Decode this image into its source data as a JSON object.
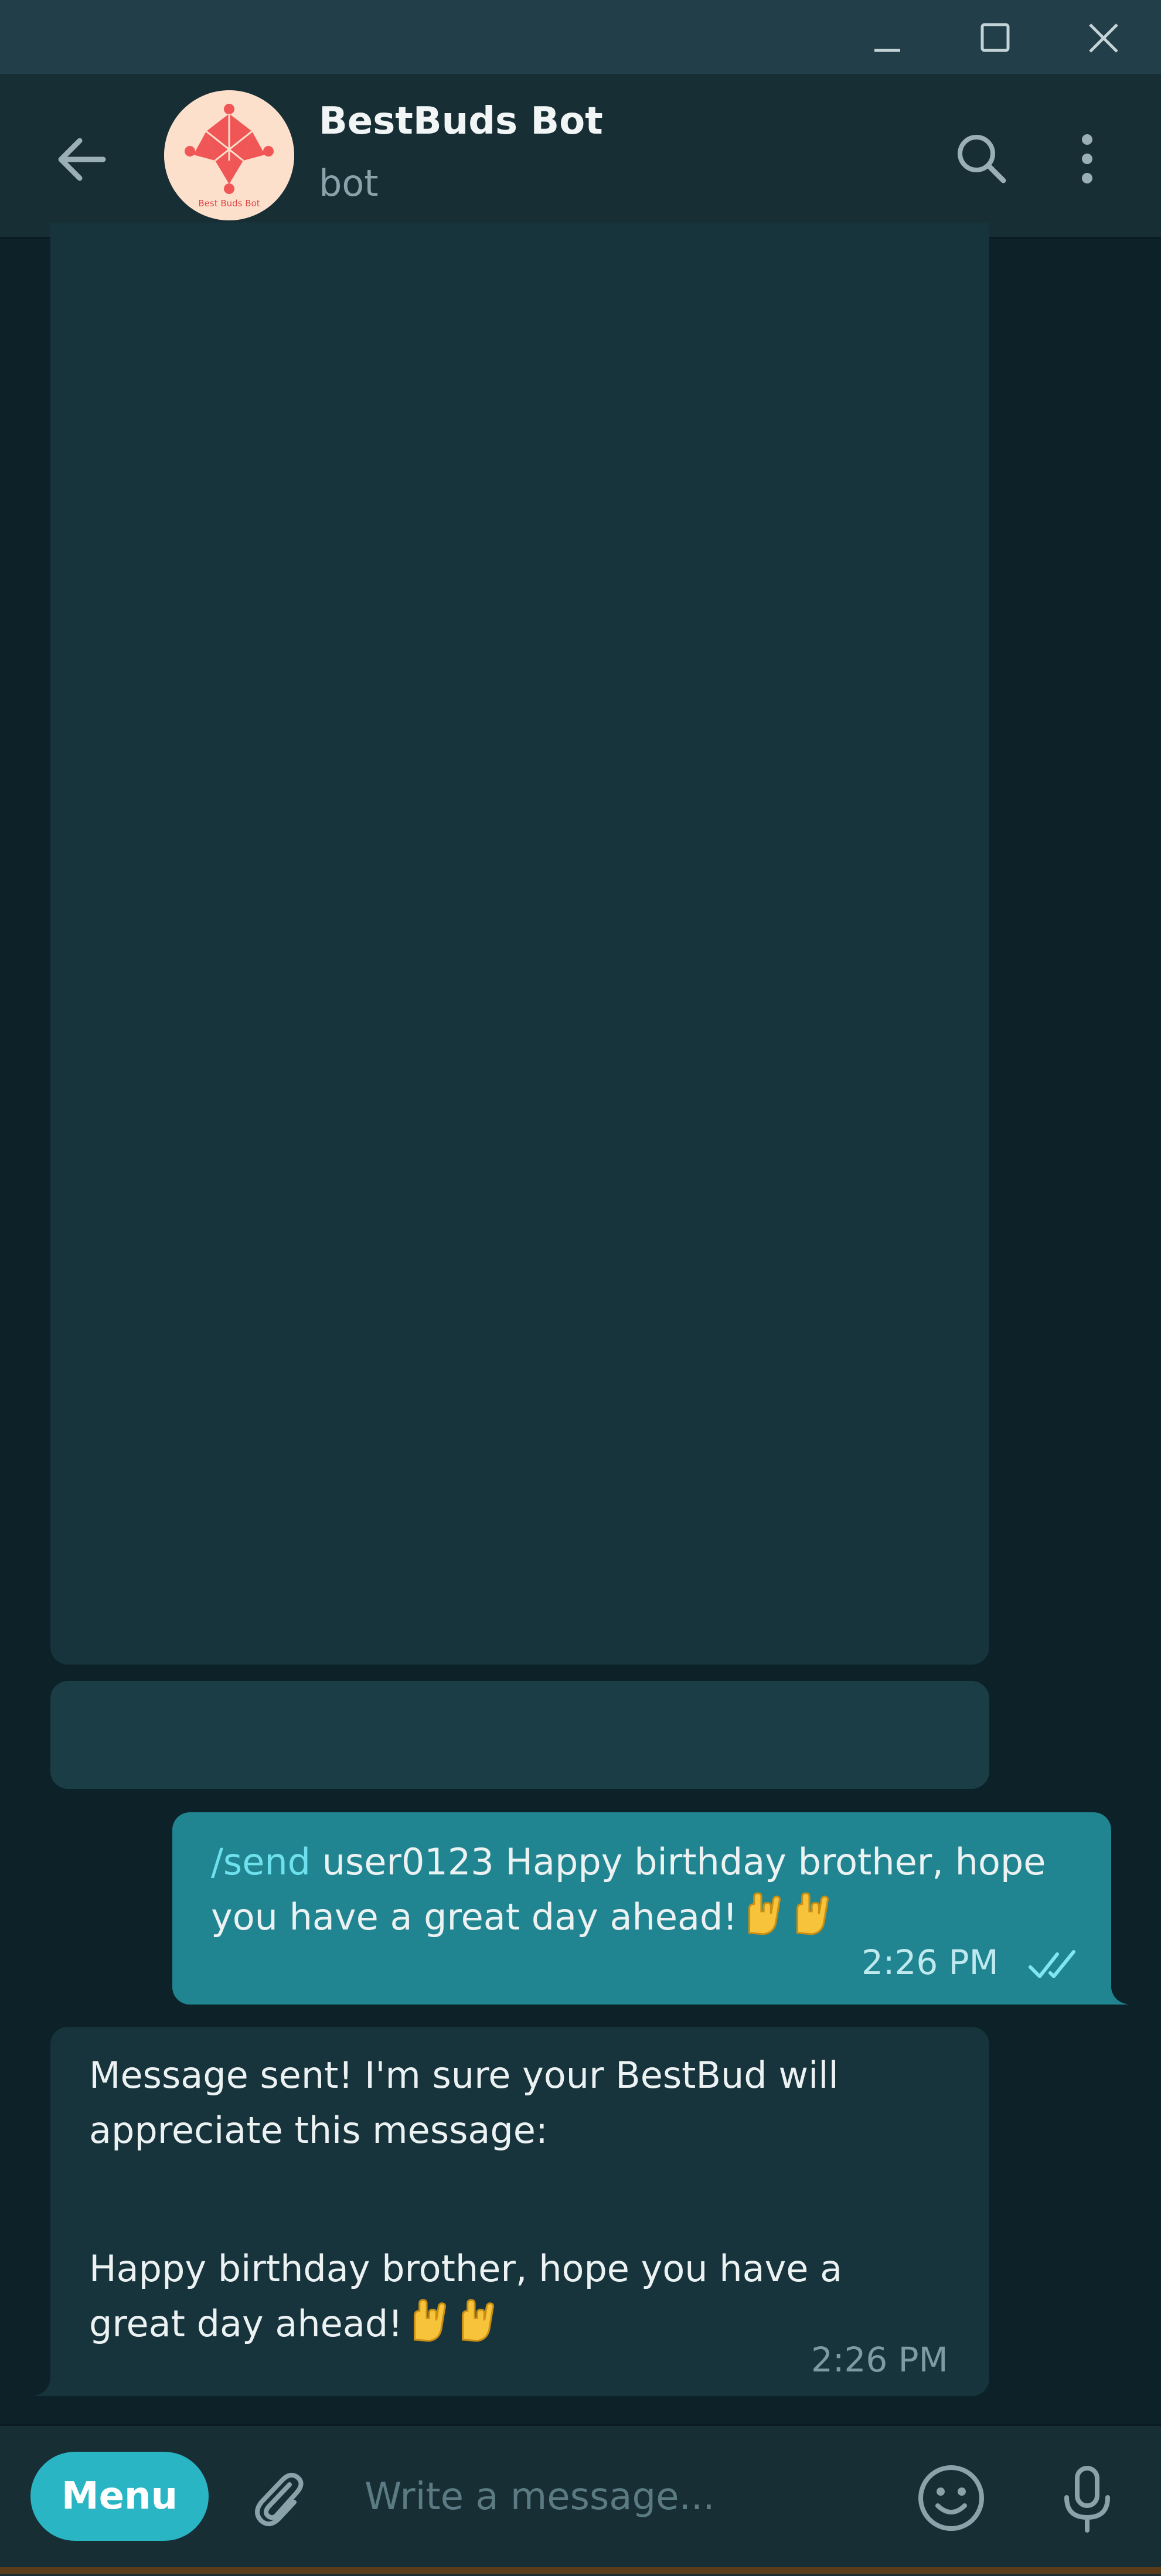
{
  "window": {
    "controls": [
      "minimize-icon",
      "maximize-icon",
      "close-icon"
    ]
  },
  "header": {
    "title": "BestBuds Bot",
    "subtitle": "bot",
    "avatar_logo_text": "Best Buds Bot",
    "icons": [
      "back-arrow-icon",
      "search-icon",
      "more-vertical-icon"
    ]
  },
  "messages": [
    {
      "direction": "incoming",
      "kind": "media-placeholder"
    },
    {
      "direction": "incoming",
      "kind": "keyboard-placeholder"
    },
    {
      "direction": "outgoing",
      "command": "/send",
      "line1_rest": " user0123 Happy birthday brother, hope",
      "line2": "you have a great day ahead!",
      "emojis": [
        "love-you-gesture-emoji",
        "love-you-gesture-emoji"
      ],
      "time": "2:26 PM",
      "status_icon": "double-check-icon"
    },
    {
      "direction": "incoming",
      "line1": "Message sent! I'm sure your BestBud will",
      "line2": "appreciate this message:",
      "line3": "Happy birthday brother, hope you have a",
      "line4": "great day ahead!",
      "emojis": [
        "love-you-gesture-emoji",
        "love-you-gesture-emoji"
      ],
      "time": "2:26 PM"
    }
  ],
  "composer": {
    "menu_label": "Menu",
    "placeholder": "Write a message...",
    "icons": [
      "paperclip-icon",
      "emoji-icon",
      "microphone-icon"
    ]
  },
  "colors": {
    "background": "#0c2128",
    "incoming_bubble": "#17343d",
    "outgoing_bubble": "#208591",
    "accent": "#2ab5c4",
    "command": "#6ee0ee"
  }
}
